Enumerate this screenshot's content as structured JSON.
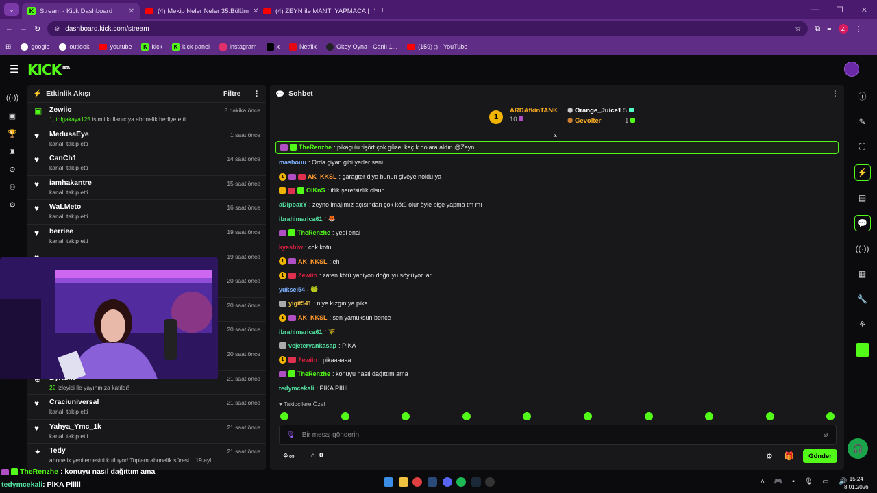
{
  "browser": {
    "tabs": [
      {
        "title": "Stream - Kick Dashboard",
        "active": true
      },
      {
        "title": "(4) Mekip Neler Neler 35.Bölüm",
        "active": false
      },
      {
        "title": "(4) ZEYN ile MANTI YAPMACA |",
        "active": false
      }
    ],
    "url": "dashboard.kick.com/stream",
    "profile_initial": "Z",
    "bookmarks": [
      "google",
      "outlook",
      "youtube",
      "kick",
      "kick panel",
      "instagram",
      "x",
      "Netflix",
      "Okey Oyna - Canlı 1...",
      "(159) ;) - YouTube"
    ]
  },
  "kick": {
    "logo": "KICK",
    "logo_beta": "BETA"
  },
  "activity": {
    "title": "Etkinlik Akışı",
    "filter_label": "Filtre",
    "items": [
      {
        "icon": "gift-icon",
        "name": "Zewiio",
        "sub_highlight": "1, tolgakaya125",
        "sub": " isimli kullanıcıya abonelik hediye etti.",
        "time": "8 dakika önce"
      },
      {
        "icon": "heart-icon",
        "name": "MedusaEye",
        "sub_highlight": "",
        "sub": "kanalı takip etti",
        "time": "1 saat önce"
      },
      {
        "icon": "heart-icon",
        "name": "CanCh1",
        "sub_highlight": "",
        "sub": "kanalı takip etti",
        "time": "14 saat önce"
      },
      {
        "icon": "heart-icon",
        "name": "iamhakantre",
        "sub_highlight": "",
        "sub": "kanalı takip etti",
        "time": "15 saat önce"
      },
      {
        "icon": "heart-icon",
        "name": "WaLMeto",
        "sub_highlight": "",
        "sub": "kanalı takip etti",
        "time": "16 saat önce"
      },
      {
        "icon": "heart-icon",
        "name": "berriee",
        "sub_highlight": "",
        "sub": "kanalı takip etti",
        "time": "19 saat önce"
      },
      {
        "icon": "heart-icon",
        "name": "",
        "sub_highlight": "",
        "sub": "",
        "time": "19 saat önce"
      },
      {
        "icon": "heart-icon",
        "name": "",
        "sub_highlight": "",
        "sub": "",
        "time": "20 saat önce"
      },
      {
        "icon": "heart-icon",
        "name": "",
        "sub_highlight": "",
        "sub": "",
        "time": "20 saat önce"
      },
      {
        "icon": "heart-icon",
        "name": "",
        "sub_highlight": "",
        "sub": "",
        "time": "20 saat önce"
      },
      {
        "icon": "heart-icon",
        "name": "",
        "sub_highlight": "",
        "sub": "",
        "time": "20 saat önce"
      },
      {
        "icon": "host-icon",
        "name": "ByRuke",
        "sub_highlight": "22",
        "sub": " izleyici ile yayınınıza katıldı!",
        "time": "21 saat önce"
      },
      {
        "icon": "heart-icon",
        "name": "Craciuniversal",
        "sub_highlight": "",
        "sub": "kanalı takip etti",
        "time": "21 saat önce"
      },
      {
        "icon": "heart-icon",
        "name": "Yahya_Ymc_1k",
        "sub_highlight": "",
        "sub": "kanalı takip etti",
        "time": "21 saat önce"
      },
      {
        "icon": "star-icon",
        "name": "Tedy",
        "sub_highlight": "",
        "sub": "abonelik yenilemesini kutluyor! Toplam abonelik süresi... 19 ayl",
        "time": "21 saat önce"
      }
    ]
  },
  "chat": {
    "title": "Sohbet",
    "leaderboard": {
      "first": {
        "name": "ARDAfkinTANK",
        "count": "10"
      },
      "second": {
        "name": "Orange_Juice1",
        "count": "5"
      },
      "third": {
        "name": "Gevolter",
        "count": "1"
      }
    },
    "pinned": {
      "user": "TheRenzhe",
      "text": ": pikaçulu tişört çok güzel kaç k dolara aldın @Zeyn",
      "user_color": "#53fc18"
    },
    "messages": [
      {
        "badges": [],
        "user": "mashouu",
        "color": "#7fb2ff",
        "text": ": Orda çiyan gibi yerler seni"
      },
      {
        "badges": [
          "one",
          "sub",
          "mod"
        ],
        "user": "AK_KKSL",
        "color": "#ff9a2e",
        "text": ": garagter diyo bunun şiveye noldu ya"
      },
      {
        "badges": [
          "crown",
          "mod",
          "gift"
        ],
        "user": "OlKnS",
        "color": "#53fc18",
        "text": ": itlik şerefsizlik olsun"
      },
      {
        "badges": [],
        "user": "aDipoaxY",
        "color": "#53e0a0",
        "text": ": zeyno imajımız açısından çok kötü olur öyle bişe yapma tm mı"
      },
      {
        "badges": [],
        "user": "ibrahimarica61",
        "color": "#53e0a0",
        "text": ": 🦊"
      },
      {
        "badges": [
          "sub",
          "gift"
        ],
        "user": "TheRenzhe",
        "color": "#53fc18",
        "text": ": yedi enai"
      },
      {
        "badges": [],
        "user": "kyeshiw",
        "color": "#e02040",
        "text": ": cok kotu"
      },
      {
        "badges": [
          "one",
          "sub"
        ],
        "user": "AK_KKSL",
        "color": "#ff9a2e",
        "text": ": eh"
      },
      {
        "badges": [
          "one",
          "mod"
        ],
        "user": "Zewiio",
        "color": "#e02040",
        "text": ": zaten kötü yapiyon doğruyu söylüyor lar"
      },
      {
        "badges": [],
        "user": "yuksel54",
        "color": "#7fb2ff",
        "text": ": 🐸"
      },
      {
        "badges": [
          "wolf"
        ],
        "user": "yigit541",
        "color": "#f0c040",
        "text": ": niye kızgın ya pika"
      },
      {
        "badges": [
          "one",
          "sub"
        ],
        "user": "AK_KKSL",
        "color": "#ff9a2e",
        "text": ": sen yamuksun bence"
      },
      {
        "badges": [],
        "user": "ibrahimarica61",
        "color": "#53e0a0",
        "text": ": 🌾"
      },
      {
        "badges": [
          "wolf"
        ],
        "user": "vejeteryankasap",
        "color": "#53e0a0",
        "text": ": PIKA"
      },
      {
        "badges": [
          "one",
          "mod"
        ],
        "user": "Zewiio",
        "color": "#e02040",
        "text": ": pikaaaaaa"
      },
      {
        "badges": [
          "sub",
          "gift"
        ],
        "user": "TheRenzhe",
        "color": "#53fc18",
        "text": ": konuyu nasıl dağıttım ama"
      },
      {
        "badges": [],
        "user": "tedymcekali",
        "color": "#53e0a0",
        "text": ": PİKA Pİİİİİ"
      }
    ],
    "followers_only": "Takipçilere Özel",
    "input_placeholder": "Bir mesaj gönderin",
    "send_label": "Gönder",
    "points": "0"
  },
  "overlay": {
    "line1_user": "TheRenzhe",
    "line1_text": ": konuyu nasıl dağıttım ama",
    "line2_user": "tedymcekali",
    "line2_text": ": PİKA Pİİİİİ"
  },
  "system": {
    "time": "15:24",
    "date": "8.01.2026"
  }
}
